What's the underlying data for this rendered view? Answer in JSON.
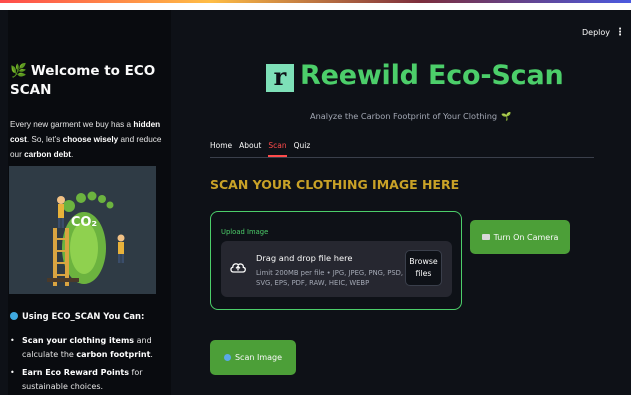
{
  "header": {
    "deploy_label": "Deploy",
    "menu_glyph": "⋮"
  },
  "sidebar": {
    "title_icon": "🌿",
    "title": "Welcome to ECO SCAN",
    "intro": {
      "p1": "Every new garment we buy has a ",
      "b1": "hidden cost",
      "p2": ". So, let’s ",
      "b2": "choose wisely",
      "p3": " and reduce our ",
      "b3": "carbon debt",
      "p4": "."
    },
    "illustration": {
      "badge": "CO₂"
    },
    "subheading": "Using ECO_SCAN You Can:",
    "bullets": [
      {
        "pre": "",
        "bold": "Scan your clothing items",
        "mid": " and calculate the ",
        "bold2": "carbon footprint",
        "post": "."
      },
      {
        "pre": "",
        "bold": "Earn Eco Reward Points",
        "mid": " for sustainable choices.",
        "bold2": "",
        "post": ""
      }
    ]
  },
  "app": {
    "logo_letter": "r",
    "title": "Reewild Eco-Scan",
    "tagline": "Analyze the Carbon Footprint of Your Clothing",
    "tagline_icon": "🌱"
  },
  "tabs": [
    {
      "label": "Home",
      "active": false
    },
    {
      "label": "About",
      "active": false
    },
    {
      "label": "Scan",
      "active": true
    },
    {
      "label": "Quiz",
      "active": false
    }
  ],
  "scan": {
    "heading": "SCAN YOUR CLOTHING IMAGE HERE",
    "upload_label": "Upload Image",
    "drop_title": "Drag and drop file here",
    "limit_text": "Limit 200MB per file • JPG, JPEG, PNG, PSD, SVG, EPS, PDF, RAW, HEIC, WEBP",
    "browse_line1": "Browse",
    "browse_line2": "files",
    "camera_button": "Turn On Camera",
    "scan_button": "Scan Image"
  },
  "icons": [
    "leaf-icon",
    "globe-icon",
    "cloud-upload-icon",
    "camera-icon",
    "scan-icon",
    "sprout-icon"
  ],
  "colors": {
    "accent_green": "#4cce6a",
    "button_green": "#4c9f38",
    "heading_gold": "#c9a227",
    "tab_active": "#ff4b4b",
    "background": "#0e1117"
  }
}
